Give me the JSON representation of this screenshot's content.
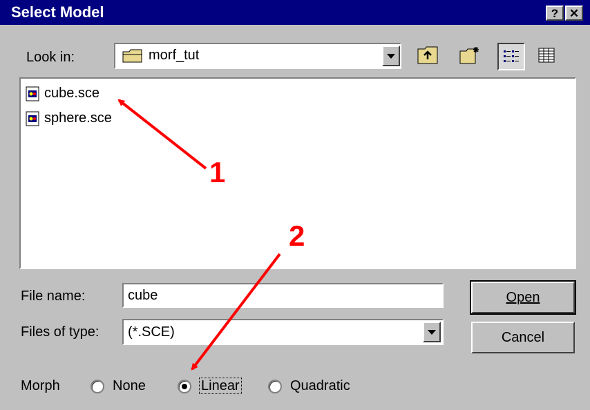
{
  "window": {
    "title": "Select Model",
    "help_label": "?",
    "close_label": "✕"
  },
  "look_in": {
    "label": "Look in:",
    "value": "morf_tut",
    "icon": "folder-icon"
  },
  "toolbar": {
    "up_icon": "up-folder-icon",
    "new_folder_icon": "new-folder-icon",
    "list_icon": "list-view-icon",
    "details_icon": "details-view-icon"
  },
  "files": [
    {
      "name": "cube.sce",
      "icon": "scene-file-icon"
    },
    {
      "name": "sphere.sce",
      "icon": "scene-file-icon"
    }
  ],
  "file_name": {
    "label": "File name:",
    "value": "cube"
  },
  "files_of_type": {
    "label": "Files of type:",
    "value": "(*.SCE)"
  },
  "buttons": {
    "open": "Open",
    "cancel": "Cancel"
  },
  "morph": {
    "label": "Morph",
    "options": [
      "None",
      "Linear",
      "Quadratic"
    ],
    "selected": "Linear"
  },
  "annotations": [
    "1",
    "2"
  ],
  "colors": {
    "titlebar": "#000080",
    "face": "#c0c0c0",
    "annotation": "#ff0000"
  }
}
